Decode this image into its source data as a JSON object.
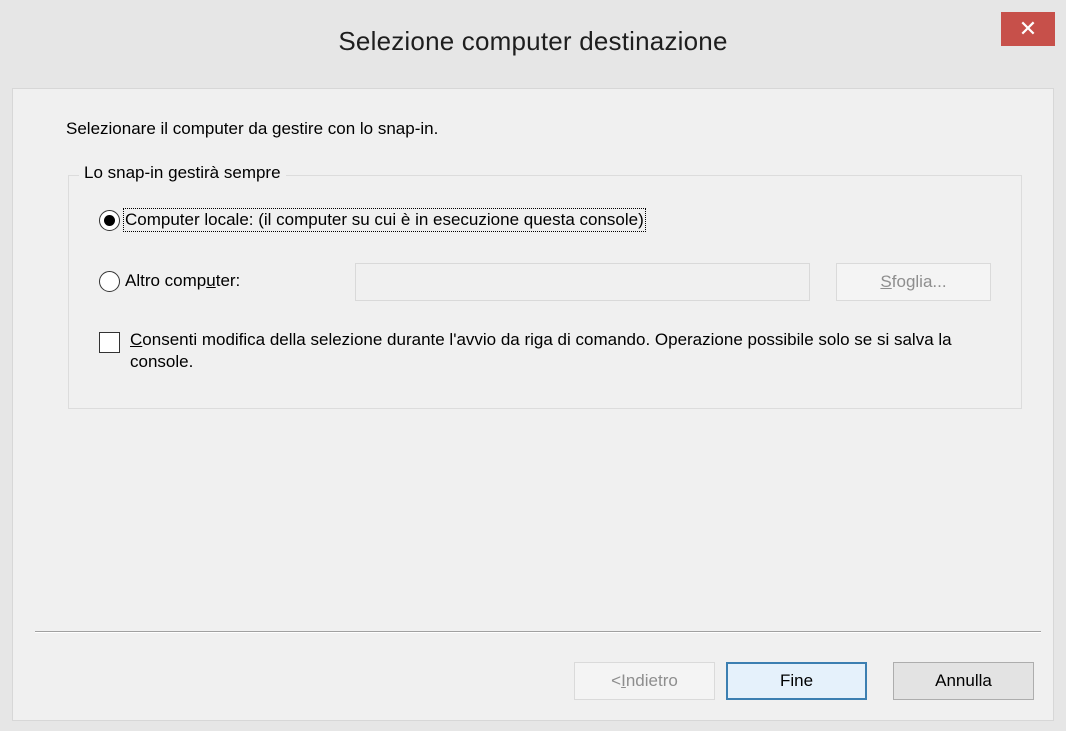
{
  "window": {
    "title": "Selezione computer destinazione",
    "close_glyph": "✕"
  },
  "dialog": {
    "instruction": "Selezionare il computer da gestire con lo snap-in.",
    "group_title": "Lo snap-in gestirà sempre",
    "local_option": {
      "label": "Computer locale: (il computer su cui è in esecuzione questa console)",
      "selected": true
    },
    "other_option": {
      "label_prefix": "Altro comp",
      "label_mnemonic": "u",
      "label_suffix": "ter:",
      "selected": false,
      "computer_name_value": ""
    },
    "browse_button": {
      "mnemonic": "S",
      "rest": "foglia..."
    },
    "allow_change_checkbox": {
      "label_mnemonic": "C",
      "label_rest": "onsenti modifica della selezione durante l'avvio da riga di comando. Operazione possibile solo se si salva la console.",
      "checked": false
    }
  },
  "footer": {
    "back_button": {
      "prefix": "< ",
      "mnemonic": "I",
      "rest": "ndietro"
    },
    "finish_label": "Fine",
    "cancel_label": "Annulla"
  }
}
